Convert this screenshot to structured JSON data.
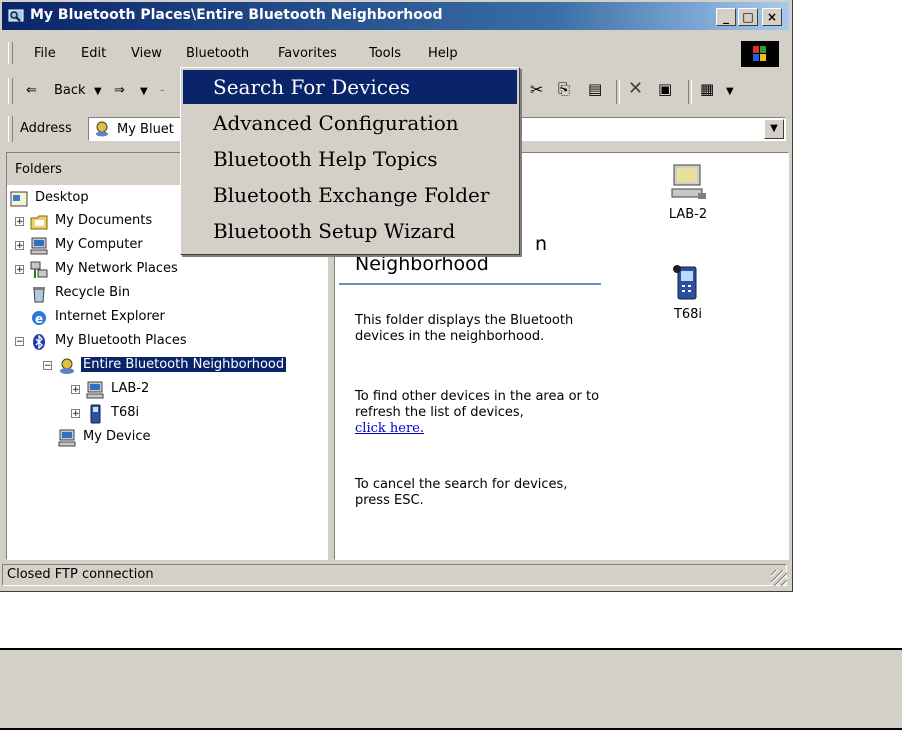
{
  "window": {
    "title": "My Bluetooth Places\\Entire Bluetooth Neighborhood",
    "controls": {
      "minimize": "_",
      "maximize": "□",
      "close": "×"
    }
  },
  "menubar": {
    "items": [
      "File",
      "Edit",
      "View",
      "Bluetooth",
      "Favorites",
      "Tools",
      "Help"
    ]
  },
  "toolbar": {
    "back_label": "Back"
  },
  "address": {
    "label": "Address",
    "value": "My Bluet"
  },
  "bluetooth_menu": {
    "items": [
      "Search For Devices",
      "Advanced Configuration",
      "Bluetooth Help Topics",
      "Bluetooth Exchange Folder",
      "Bluetooth Setup Wizard"
    ],
    "highlighted_index": 0
  },
  "folders_pane": {
    "header": "Folders",
    "tree": [
      {
        "label": "Desktop"
      },
      {
        "label": "My Documents"
      },
      {
        "label": "My Computer"
      },
      {
        "label": "My Network Places"
      },
      {
        "label": "Recycle Bin"
      },
      {
        "label": "Internet Explorer"
      },
      {
        "label": "My Bluetooth Places"
      },
      {
        "label": "Entire Bluetooth Neighborhood",
        "selected": true
      },
      {
        "label": "LAB-2"
      },
      {
        "label": "T68i"
      },
      {
        "label": "My Device"
      }
    ]
  },
  "content": {
    "heading_fragment": "n",
    "heading": "Neighborhood",
    "paragraph1": "This folder displays the Bluetooth devices in the neighborhood.",
    "paragraph2": "To find other devices in the area or to refresh the list of devices,",
    "link": "click here.",
    "paragraph3": "To cancel the search for devices, press ESC.",
    "devices": [
      {
        "label": "LAB-2",
        "icon": "computer-icon"
      },
      {
        "label": "T68i",
        "icon": "phone-icon"
      }
    ]
  },
  "statusbar": {
    "text": "Closed FTP connection"
  },
  "colors": {
    "title_gradient_start": "#0a246a",
    "menu_highlight": "#0a246a",
    "chrome": "#d4d0c8"
  }
}
